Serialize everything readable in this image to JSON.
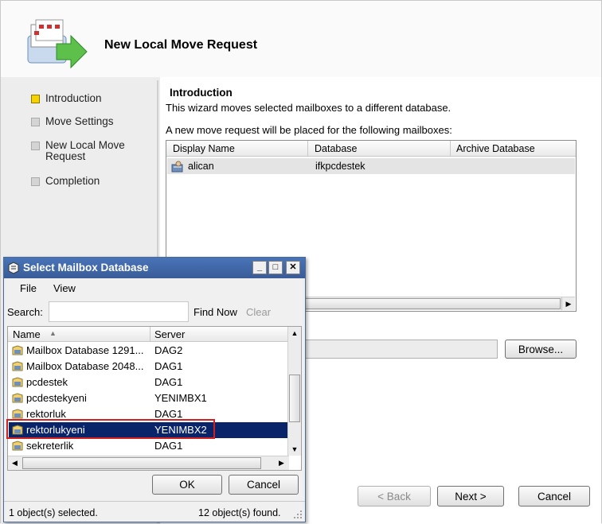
{
  "wizard": {
    "title": "New Local Move Request",
    "steps": [
      {
        "label": "Introduction",
        "active": true
      },
      {
        "label": "Move Settings",
        "active": false
      },
      {
        "label_line1": "New Local Move",
        "label_line2": "Request",
        "active": false
      },
      {
        "label": "Completion",
        "active": false
      }
    ],
    "section_title": "Introduction",
    "section_desc": "This wizard moves selected mailboxes to a different database.",
    "list_caption": "A new move request will be placed for the following mailboxes:",
    "columns": [
      "Display Name",
      "Database",
      "Archive Database"
    ],
    "rows": [
      {
        "display_name": "alican",
        "database": "ifkpcdestek",
        "archive": ""
      }
    ],
    "browse_label": "Browse...",
    "back_label": "< Back",
    "next_label": "Next >",
    "cancel_label": "Cancel"
  },
  "dialog": {
    "title": "Select Mailbox Database",
    "menu": [
      "File",
      "View"
    ],
    "search_label": "Search:",
    "search_value": "",
    "find_now": "Find Now",
    "clear": "Clear",
    "columns": [
      "Name",
      "Server"
    ],
    "sort_indicator": "▲",
    "rows": [
      {
        "name": "Mailbox Database 1291...",
        "server": "DAG2"
      },
      {
        "name": "Mailbox Database 2048...",
        "server": "DAG1"
      },
      {
        "name": "pcdestek",
        "server": "DAG1"
      },
      {
        "name": "pcdestekyeni",
        "server": "YENIMBX1"
      },
      {
        "name": "rektorluk",
        "server": "DAG1"
      },
      {
        "name": "rektorlukyeni",
        "server": "YENIMBX2",
        "selected": true
      },
      {
        "name": "sekreterlik",
        "server": "DAG1"
      }
    ],
    "ok_label": "OK",
    "cancel_label": "Cancel",
    "status_left": "1 object(s) selected.",
    "status_right": "12 object(s) found.",
    "titlebar_buttons": {
      "minimize": "_",
      "maximize": "□",
      "close": "✕"
    }
  },
  "colors": {
    "titlebar": "#3a5c98",
    "selection": "#0a246a",
    "highlight_outline": "#d02020",
    "active_step": "#f5d200"
  }
}
